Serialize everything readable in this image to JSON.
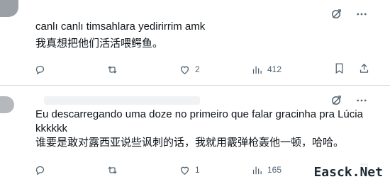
{
  "posts": [
    {
      "text_line1": "canlı canlı timsahlara yedirirrim amk",
      "text_line2": "我真想把他们活活喂鳄鱼。",
      "likes": "2",
      "views": "412"
    },
    {
      "text_line1": "Eu descarregando uma doze no primeiro que falar gracinha pra Lúcia kkkkkk",
      "text_line2": "谁要是敢对露西亚说些讽刺的话，我就用霰弹枪轰他一顿，哈哈。",
      "likes": "1",
      "views": "165"
    }
  ],
  "watermark": "Easck.Net",
  "colors": {
    "icon_gray": "#536471",
    "text": "#0f1419",
    "divider": "#cfd9de"
  }
}
